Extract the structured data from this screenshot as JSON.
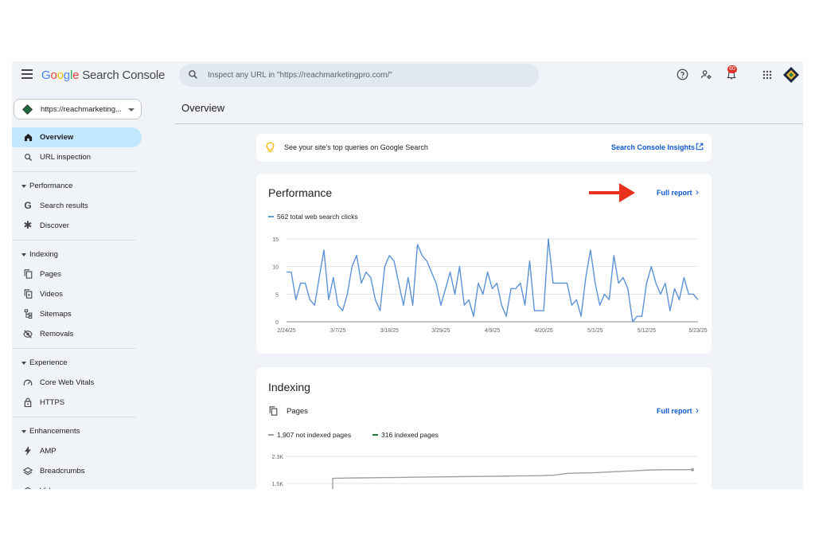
{
  "header": {
    "logo_google": [
      "G",
      "o",
      "o",
      "g",
      "l",
      "e"
    ],
    "logo_product": "Search Console",
    "search_placeholder": "Inspect any URL in \"https://reachmarketingpro.com/\"",
    "notification_count": "60"
  },
  "sidebar": {
    "property": "https://reachmarketing...",
    "items": [
      {
        "type": "item",
        "label": "Overview",
        "icon": "home-icon",
        "active": true
      },
      {
        "type": "item",
        "label": "URL inspection",
        "icon": "search-icon"
      },
      {
        "type": "divider"
      },
      {
        "type": "section",
        "label": "Performance"
      },
      {
        "type": "item",
        "label": "Search results",
        "icon": "google-g-icon"
      },
      {
        "type": "item",
        "label": "Discover",
        "icon": "asterisk-icon"
      },
      {
        "type": "divider"
      },
      {
        "type": "section",
        "label": "Indexing"
      },
      {
        "type": "item",
        "label": "Pages",
        "icon": "pages-icon"
      },
      {
        "type": "item",
        "label": "Videos",
        "icon": "video-page-icon"
      },
      {
        "type": "item",
        "label": "Sitemaps",
        "icon": "sitemap-icon"
      },
      {
        "type": "item",
        "label": "Removals",
        "icon": "eye-off-icon"
      },
      {
        "type": "divider"
      },
      {
        "type": "section",
        "label": "Experience"
      },
      {
        "type": "item",
        "label": "Core Web Vitals",
        "icon": "gauge-icon"
      },
      {
        "type": "item",
        "label": "HTTPS",
        "icon": "lock-icon"
      },
      {
        "type": "divider"
      },
      {
        "type": "section",
        "label": "Enhancements"
      },
      {
        "type": "item",
        "label": "AMP",
        "icon": "bolt-icon"
      },
      {
        "type": "item",
        "label": "Breadcrumbs",
        "icon": "layers-icon"
      },
      {
        "type": "item",
        "label": "Videos",
        "icon": "layers-icon"
      }
    ]
  },
  "main": {
    "page_title": "Overview",
    "tip": {
      "text": "See your site's top queries on Google Search",
      "link": "Search Console Insights"
    },
    "performance": {
      "title": "Performance",
      "full_report": "Full report",
      "legend": "562 total web search clicks"
    },
    "indexing": {
      "title": "Indexing",
      "subtitle": "Pages",
      "full_report": "Full report",
      "legend_not_indexed": "1,907 not indexed pages",
      "legend_indexed": "316 indexed pages"
    }
  },
  "colors": {
    "accent": "#0b57d0",
    "clicks_line": "#5c93d6",
    "not_indexed": "#9aa0a6",
    "indexed": "#188038",
    "arrow": "#e8321e",
    "active_nav": "#c2e7ff"
  },
  "chart_data": [
    {
      "type": "line",
      "title": "",
      "series": [
        {
          "name": "562 total web search clicks",
          "values": [
            9,
            9,
            4,
            7,
            7,
            4,
            3,
            8,
            13,
            4,
            8,
            3,
            2,
            5,
            10,
            12,
            7,
            9,
            8,
            4,
            2,
            10,
            12,
            11,
            7,
            3,
            8,
            3,
            14,
            12,
            11,
            9,
            7,
            3,
            6,
            9,
            5,
            10,
            3,
            4,
            1,
            7,
            5,
            9,
            6,
            7,
            3,
            1,
            6,
            6,
            7,
            3,
            11,
            2,
            2,
            2,
            15,
            7,
            7,
            7,
            7,
            3,
            4,
            1,
            8,
            13,
            7,
            3,
            5,
            4,
            12,
            7,
            8,
            6,
            0,
            1,
            1,
            7,
            10,
            7,
            5,
            7,
            2,
            6,
            4,
            8,
            5,
            5,
            4
          ]
        }
      ],
      "x_ticks": [
        "2/24/25",
        "3/7/25",
        "3/18/25",
        "3/29/25",
        "4/9/25",
        "4/20/25",
        "5/1/25",
        "5/12/25",
        "5/23/25"
      ],
      "x_range": [
        "2/24/25",
        "5/23/25"
      ],
      "y_ticks": [
        "0",
        "5",
        "10",
        "15"
      ],
      "ylim": [
        0,
        15
      ],
      "grid": true
    },
    {
      "type": "line",
      "title": "",
      "series": [
        {
          "name": "1,907 not indexed pages",
          "values": [
            1650,
            1660,
            1665,
            1670,
            1675,
            1680,
            1685,
            1690,
            1695,
            1700,
            1705,
            1710,
            1715,
            1720,
            1725,
            1730,
            1745,
            1800,
            1810,
            1820,
            1840,
            1860,
            1880,
            1900,
            1905,
            1907,
            1907
          ]
        }
      ],
      "y_ticks": [
        "1.5K",
        "2.3K"
      ],
      "grid": true
    }
  ]
}
